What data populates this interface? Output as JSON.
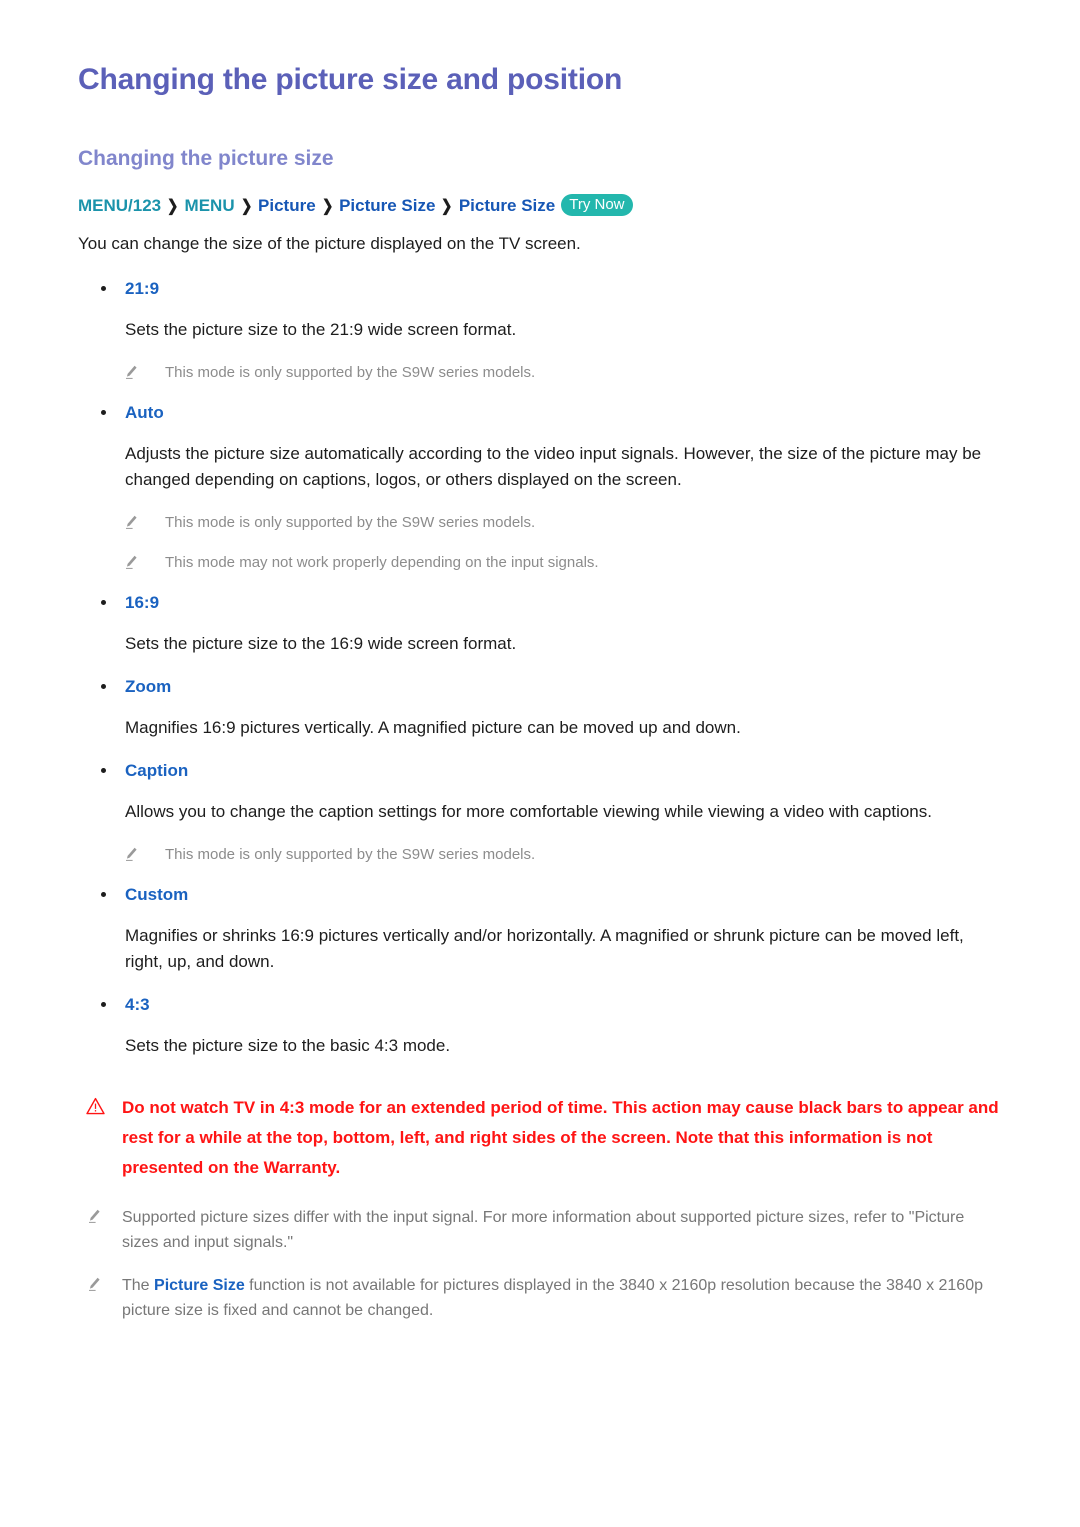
{
  "document": {
    "title": "Changing the picture size and position",
    "section_title": "Changing the picture size",
    "intro": "You can change the size of the picture displayed on the TV screen."
  },
  "breadcrumb": {
    "items": [
      {
        "label": "MENU/123",
        "color": "teal"
      },
      {
        "label": "MENU",
        "color": "teal"
      },
      {
        "label": "Picture",
        "color": "blue"
      },
      {
        "label": "Picture Size",
        "color": "blue"
      },
      {
        "label": "Picture Size",
        "color": "blue"
      }
    ],
    "separator": "❯",
    "badge": "Try Now"
  },
  "options": [
    {
      "name": "21:9",
      "description": "Sets the picture size to the 21:9 wide screen format.",
      "notes": [
        "This mode is only supported by the S9W series models."
      ]
    },
    {
      "name": "Auto",
      "description": "Adjusts the picture size automatically according to the video input signals. However, the size of the picture may be changed depending on captions, logos, or others displayed on the screen.",
      "notes": [
        "This mode is only supported by the S9W series models.",
        "This mode may not work properly depending on the input signals."
      ]
    },
    {
      "name": "16:9",
      "description": "Sets the picture size to the 16:9 wide screen format.",
      "notes": []
    },
    {
      "name": "Zoom",
      "description": "Magnifies 16:9 pictures vertically. A magnified picture can be moved up and down.",
      "notes": []
    },
    {
      "name": "Caption",
      "description": "Allows you to change the caption settings for more comfortable viewing while viewing a video with captions.",
      "notes": [
        "This mode is only supported by the S9W series models."
      ]
    },
    {
      "name": "Custom",
      "description": "Magnifies or shrinks 16:9 pictures vertically and/or horizontally. A magnified or shrunk picture can be moved left, right, up, and down.",
      "notes": []
    },
    {
      "name": "4:3",
      "description": "Sets the picture size to the basic 4:3 mode.",
      "notes": []
    }
  ],
  "warning": {
    "icon": "warning-triangle-icon",
    "text": "Do not watch TV in 4:3 mode for an extended period of time. This action may cause black bars to appear and rest for a while at the top, bottom, left, and right sides of the screen. Note that this information is not presented on the Warranty."
  },
  "footer_notes": [
    {
      "icon": "pencil-icon",
      "parts": [
        {
          "text": "Supported picture sizes differ with the input signal. For more information about supported picture sizes, refer to \"Picture sizes and input signals.\"",
          "style": "plain"
        }
      ]
    },
    {
      "icon": "pencil-icon",
      "parts": [
        {
          "text": "The ",
          "style": "plain"
        },
        {
          "text": "Picture Size",
          "style": "highlight"
        },
        {
          "text": " function is not available for pictures displayed in the 3840 x 2160p resolution because the 3840 x 2160p picture size is fixed and cannot be changed.",
          "style": "plain"
        }
      ]
    }
  ],
  "colors": {
    "h1": "#5b60b8",
    "h2": "#8186cc",
    "breadcrumb_teal": "#1b93ab",
    "breadcrumb_blue": "#1757b5",
    "badge_bg": "#23b7ad",
    "option_label": "#1a62c0",
    "note_gray": "#8c8c8c",
    "warning_red": "#ff1414",
    "body": "#1d1d1d"
  }
}
